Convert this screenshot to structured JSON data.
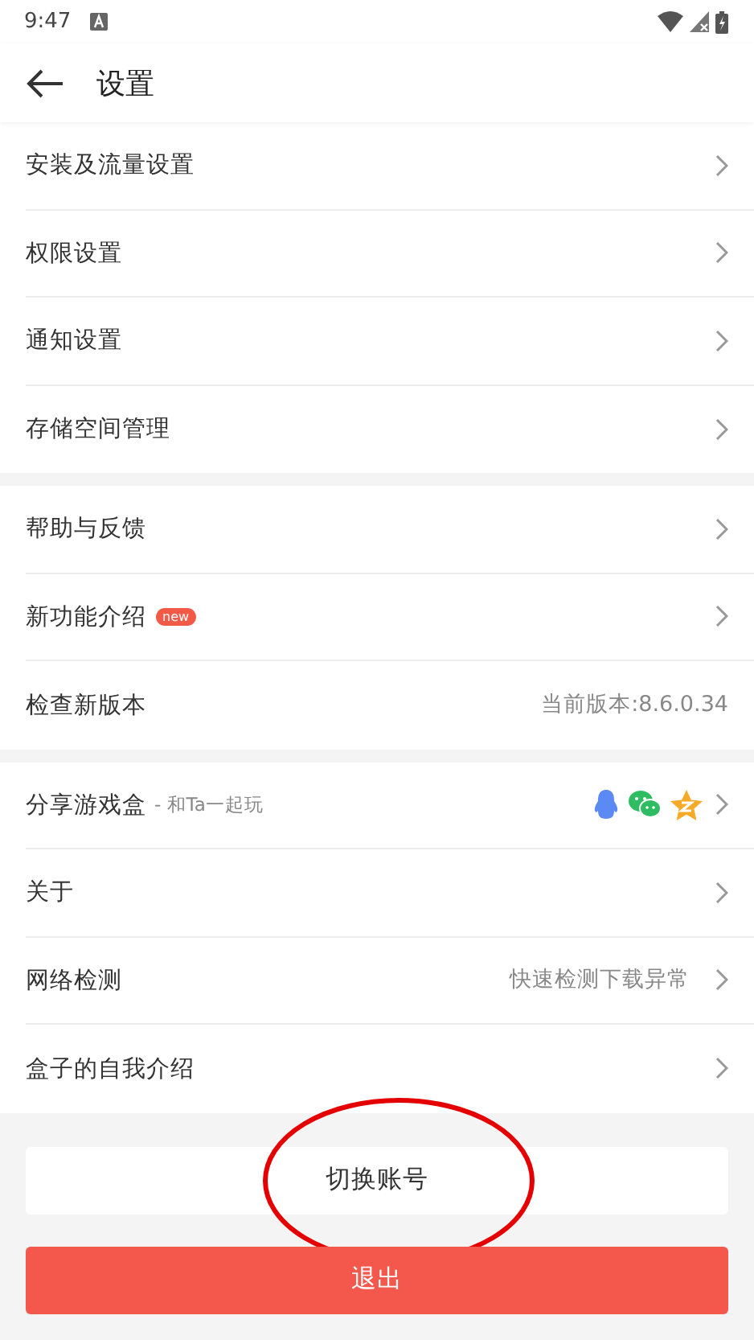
{
  "status_bar": {
    "time": "9:47"
  },
  "header": {
    "title": "设置"
  },
  "groups": [
    [
      {
        "kind": "nav",
        "label": "安装及流量设置"
      },
      {
        "kind": "nav",
        "label": "权限设置"
      },
      {
        "kind": "nav",
        "label": "通知设置"
      },
      {
        "kind": "nav",
        "label": "存储空间管理"
      }
    ],
    [
      {
        "kind": "nav",
        "label": "帮助与反馈"
      },
      {
        "kind": "nav",
        "label": "新功能介绍",
        "badge": "new"
      },
      {
        "kind": "info",
        "label": "检查新版本",
        "value": "当前版本:8.6.0.34"
      }
    ],
    [
      {
        "kind": "share",
        "label": "分享游戏盒",
        "subtitle": "- 和Ta一起玩"
      },
      {
        "kind": "nav",
        "label": "关于"
      },
      {
        "kind": "nav",
        "label": "网络检测",
        "value": "快速检测下载异常"
      },
      {
        "kind": "nav",
        "label": "盒子的自我介绍"
      }
    ]
  ],
  "buttons": [
    {
      "kind": "plain",
      "label": "切换账号",
      "annotated": true
    },
    {
      "kind": "danger",
      "label": "退出",
      "annotated": false
    }
  ]
}
